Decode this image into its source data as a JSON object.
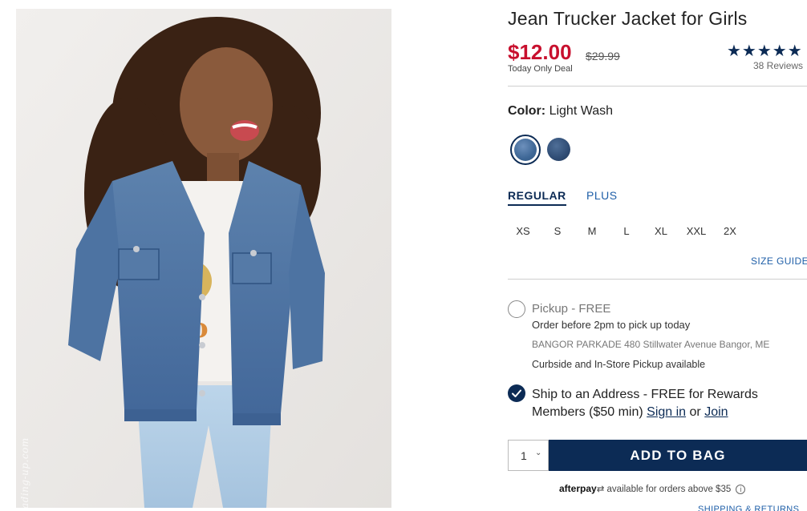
{
  "product": {
    "title": "Jean Trucker Jacket for Girls",
    "price": "$12.00",
    "original_price": "$29.99",
    "deal_label": "Today Only Deal",
    "stars": "★★★★★",
    "reviews": "38 Reviews",
    "watermark": "Fading-up.com"
  },
  "color": {
    "label": "Color:",
    "value": "Light Wash",
    "swatches": [
      "light-wash",
      "dark-wash"
    ]
  },
  "fit": {
    "tabs": [
      "REGULAR",
      "PLUS"
    ],
    "selected": "REGULAR"
  },
  "sizes": [
    "XS",
    "S",
    "M",
    "L",
    "XL",
    "XXL",
    "2X"
  ],
  "size_guide": "SIZE GUIDE",
  "fulfillment": {
    "pickup_title": "Pickup - FREE",
    "pickup_note": "Order before 2pm to pick up today",
    "store": "BANGOR PARKADE 480 Stillwater Avenue  Bangor, ME",
    "curbside": "Curbside and In-Store Pickup available",
    "ship_text": "Ship to an Address - FREE for Rewards Members ($50 min)",
    "sign_in": "Sign in",
    "or": "or",
    "join": "Join"
  },
  "cart": {
    "quantity": "1",
    "add_to_bag": "ADD TO BAG"
  },
  "afterpay": {
    "logo": "afterpay",
    "text": "available for orders above $35"
  },
  "shipping_returns": "SHIPPING & RETURNS",
  "colors": {
    "navy": "#0c2b55",
    "price_red": "#c8102e",
    "link_blue": "#1f5fa8"
  }
}
